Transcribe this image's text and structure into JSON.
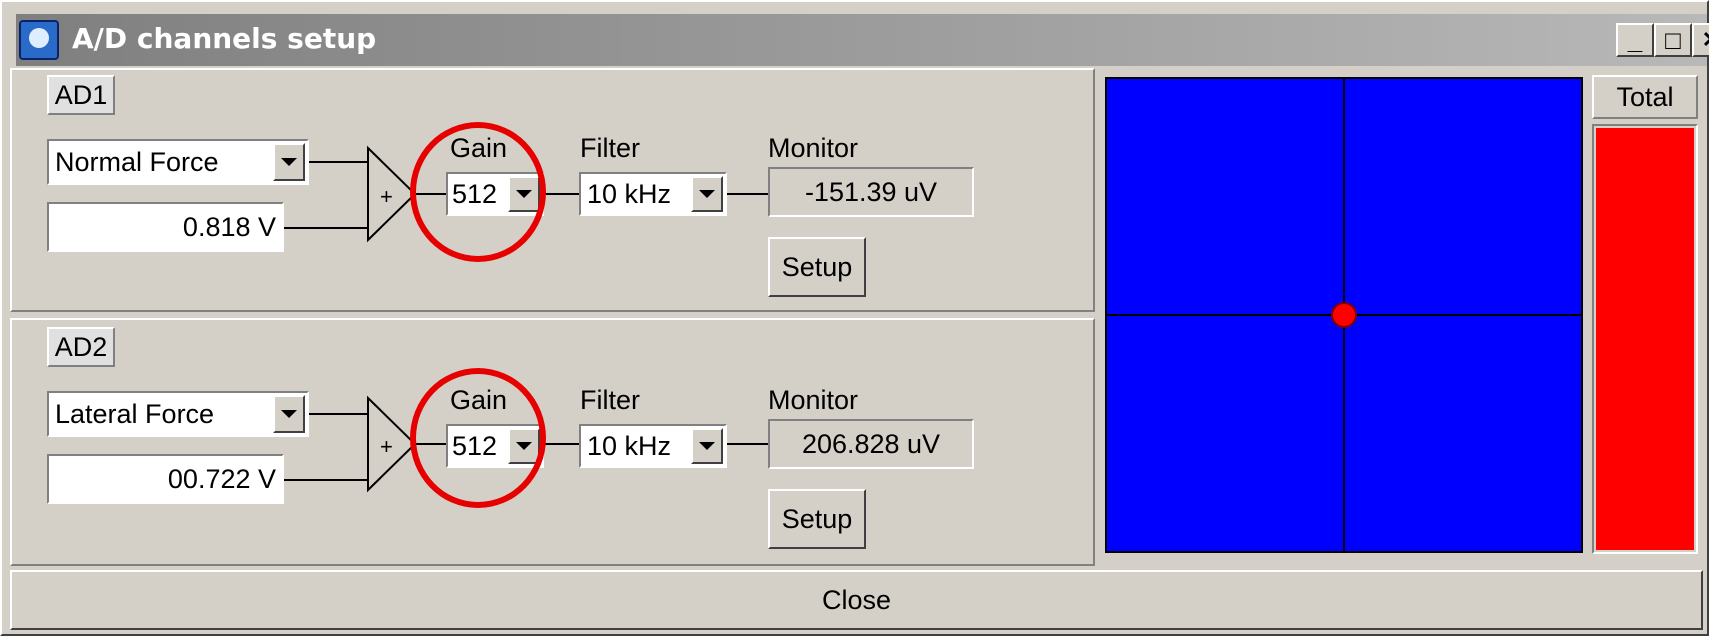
{
  "window": {
    "title": "A/D channels setup",
    "minimize_glyph": "_",
    "maximize_glyph": "□",
    "close_glyph": "✕"
  },
  "channels": [
    {
      "label": "AD1",
      "signal": "Normal Force",
      "offset": "0.818 V",
      "gain_label": "Gain",
      "gain": "512",
      "filter_label": "Filter",
      "filter": "10 kHz",
      "monitor_label": "Monitor",
      "monitor": "-151.39 uV",
      "setup_label": "Setup",
      "plus": "+"
    },
    {
      "label": "AD2",
      "signal": "Lateral Force",
      "offset": "00.722 V",
      "gain_label": "Gain",
      "gain": "512",
      "filter_label": "Filter",
      "filter": "10 kHz",
      "monitor_label": "Monitor",
      "monitor": "206.828 uV",
      "setup_label": "Setup",
      "plus": "+"
    }
  ],
  "plot": {
    "background": "#0000ff",
    "crosshair_color": "#000000",
    "marker_color": "#ff0000",
    "marker_x": 0.0,
    "marker_y": 0.0
  },
  "total": {
    "label": "Total",
    "level": 1.0,
    "color": "#ff0000"
  },
  "close_label": "Close",
  "annotation_color": "#e60000"
}
